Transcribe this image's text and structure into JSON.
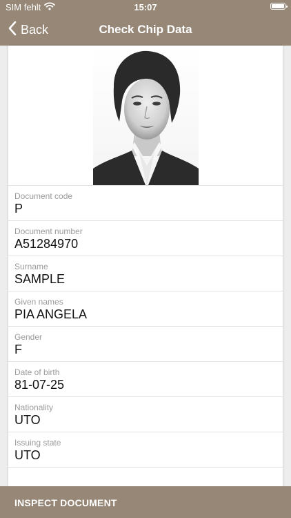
{
  "status_bar": {
    "carrier": "SIM fehlt",
    "time": "15:07"
  },
  "nav": {
    "back_label": "Back",
    "title": "Check Chip Data"
  },
  "fields": [
    {
      "label": "Document code",
      "value": "P"
    },
    {
      "label": "Document number",
      "value": "A51284970"
    },
    {
      "label": "Surname",
      "value": "SAMPLE"
    },
    {
      "label": "Given names",
      "value": "PIA ANGELA"
    },
    {
      "label": "Gender",
      "value": "F"
    },
    {
      "label": "Date of birth",
      "value": "81-07-25"
    },
    {
      "label": "Nationality",
      "value": "UTO"
    },
    {
      "label": "Issuing state",
      "value": "UTO"
    }
  ],
  "footer": {
    "inspect_label": "INSPECT DOCUMENT"
  },
  "colors": {
    "bar": "#968776",
    "label": "#9b9b9b",
    "value": "#111111"
  },
  "icons": [
    "wifi-icon",
    "battery-icon",
    "chevron-left-icon",
    "portrait-photo"
  ]
}
